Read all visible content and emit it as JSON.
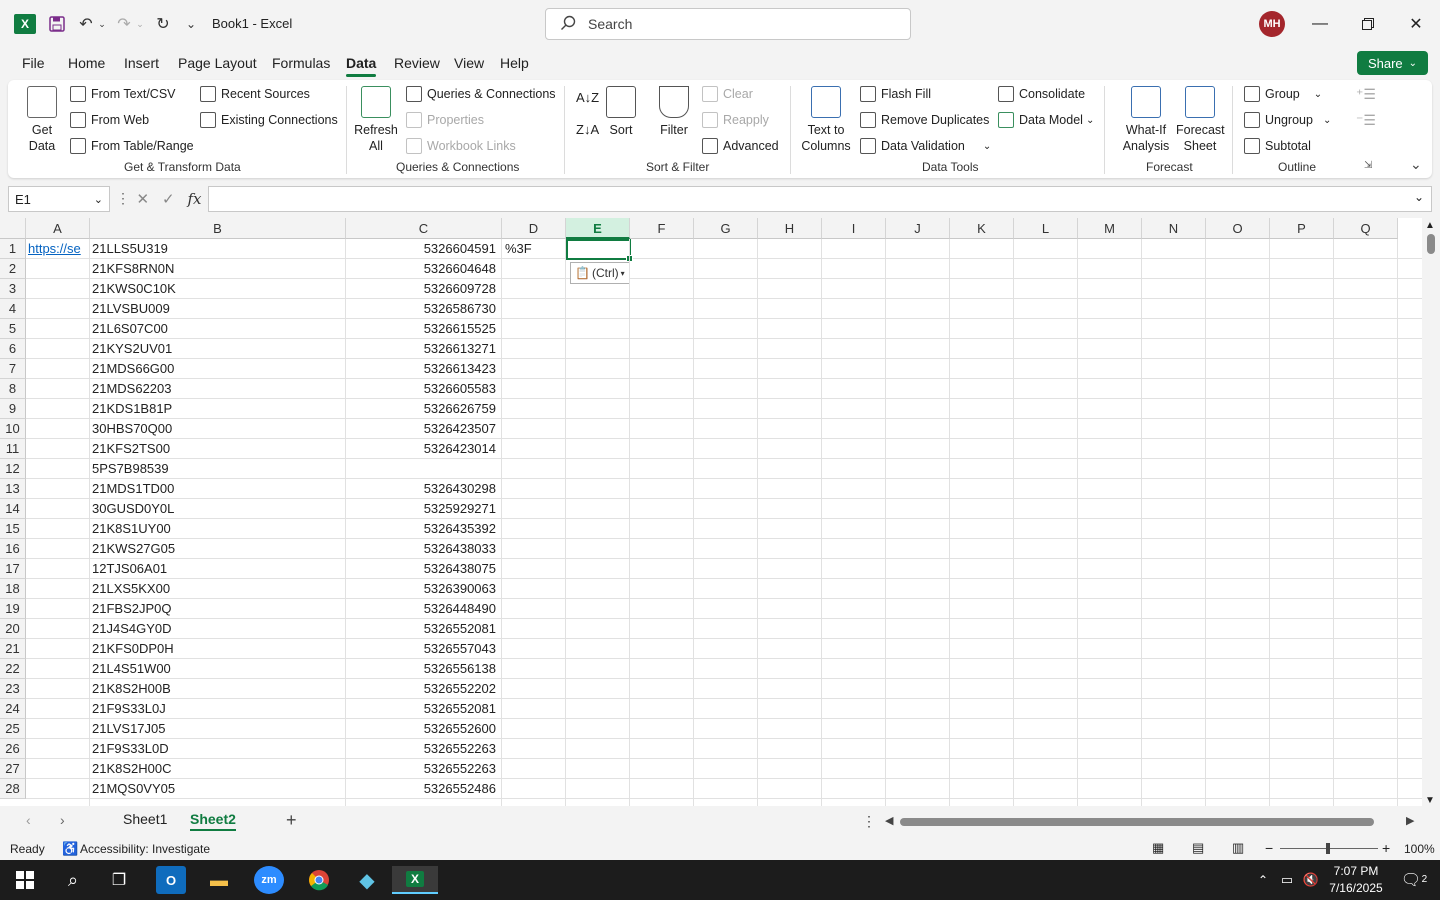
{
  "window": {
    "title": "Book1  -  Excel",
    "search_placeholder": "Search",
    "avatar_initials": "MH"
  },
  "menu": {
    "tabs": [
      "File",
      "Home",
      "Insert",
      "Page Layout",
      "Formulas",
      "Data",
      "Review",
      "View",
      "Help"
    ],
    "active": "Data",
    "share_label": "Share"
  },
  "ribbon": {
    "get_transform": {
      "get_data": "Get\nData",
      "from_text_csv": "From Text/CSV",
      "from_web": "From Web",
      "from_table": "From Table/Range",
      "recent_sources": "Recent Sources",
      "existing_connections": "Existing Connections",
      "group_label": "Get & Transform Data"
    },
    "queries": {
      "refresh_all": "Refresh\nAll",
      "queries_connections": "Queries & Connections",
      "properties": "Properties",
      "workbook_links": "Workbook Links",
      "group_label": "Queries & Connections"
    },
    "sort_filter": {
      "sort": "Sort",
      "filter": "Filter",
      "clear": "Clear",
      "reapply": "Reapply",
      "advanced": "Advanced",
      "group_label": "Sort & Filter"
    },
    "data_tools": {
      "text_to_columns": "Text to\nColumns",
      "flash_fill": "Flash Fill",
      "remove_duplicates": "Remove Duplicates",
      "data_validation": "Data Validation",
      "consolidate": "Consolidate",
      "data_model": "Data Model",
      "group_label": "Data Tools"
    },
    "forecast": {
      "what_if": "What-If\nAnalysis",
      "forecast_sheet": "Forecast\nSheet",
      "group_label": "Forecast"
    },
    "outline": {
      "group": "Group",
      "ungroup": "Ungroup",
      "subtotal": "Subtotal",
      "group_label": "Outline"
    }
  },
  "formula_bar": {
    "name_box": "E1",
    "formula": ""
  },
  "grid": {
    "columns": [
      "A",
      "B",
      "C",
      "D",
      "E",
      "F",
      "G",
      "H",
      "I",
      "J",
      "K",
      "L",
      "M",
      "N",
      "O",
      "P",
      "Q"
    ],
    "selected_column": "E",
    "rows": [
      {
        "n": "1",
        "a": "https://se",
        "b": "21LLS5U319",
        "c": "5326604591",
        "d": "%3F"
      },
      {
        "n": "2",
        "a": "",
        "b": "21KFS8RN0N",
        "c": "5326604648",
        "d": ""
      },
      {
        "n": "3",
        "a": "",
        "b": "21KWS0C10K",
        "c": "5326609728",
        "d": ""
      },
      {
        "n": "4",
        "a": "",
        "b": "21LVSBU009",
        "c": "5326586730",
        "d": ""
      },
      {
        "n": "5",
        "a": "",
        "b": "21L6S07C00",
        "c": "5326615525",
        "d": ""
      },
      {
        "n": "6",
        "a": "",
        "b": "21KYS2UV01",
        "c": "5326613271",
        "d": ""
      },
      {
        "n": "7",
        "a": "",
        "b": "21MDS66G00",
        "c": "5326613423",
        "d": ""
      },
      {
        "n": "8",
        "a": "",
        "b": "21MDS62203",
        "c": "5326605583",
        "d": ""
      },
      {
        "n": "9",
        "a": "",
        "b": "21KDS1B81P",
        "c": "5326626759",
        "d": ""
      },
      {
        "n": "10",
        "a": "",
        "b": "30HBS70Q00",
        "c": "5326423507",
        "d": ""
      },
      {
        "n": "11",
        "a": "",
        "b": "21KFS2TS00",
        "c": "5326423014",
        "d": ""
      },
      {
        "n": "12",
        "a": "",
        "b": "5PS7B98539",
        "c": "",
        "d": ""
      },
      {
        "n": "13",
        "a": "",
        "b": "21MDS1TD00",
        "c": "5326430298",
        "d": ""
      },
      {
        "n": "14",
        "a": "",
        "b": "30GUSD0Y0L",
        "c": "5325929271",
        "d": ""
      },
      {
        "n": "15",
        "a": "",
        "b": "21K8S1UY00",
        "c": "5326435392",
        "d": ""
      },
      {
        "n": "16",
        "a": "",
        "b": "21KWS27G05",
        "c": "5326438033",
        "d": ""
      },
      {
        "n": "17",
        "a": "",
        "b": "12TJS06A01",
        "c": "5326438075",
        "d": ""
      },
      {
        "n": "18",
        "a": "",
        "b": "21LXS5KX00",
        "c": "5326390063",
        "d": ""
      },
      {
        "n": "19",
        "a": "",
        "b": "21FBS2JP0Q",
        "c": "5326448490",
        "d": ""
      },
      {
        "n": "20",
        "a": "",
        "b": "21J4S4GY0D",
        "c": "5326552081",
        "d": ""
      },
      {
        "n": "21",
        "a": "",
        "b": "21KFS0DP0H",
        "c": "5326557043",
        "d": ""
      },
      {
        "n": "22",
        "a": "",
        "b": "21L4S51W00",
        "c": "5326556138",
        "d": ""
      },
      {
        "n": "23",
        "a": "",
        "b": "21K8S2H00B",
        "c": "5326552202",
        "d": ""
      },
      {
        "n": "24",
        "a": "",
        "b": "21F9S33L0J",
        "c": "5326552081",
        "d": ""
      },
      {
        "n": "25",
        "a": "",
        "b": "21LVS17J05",
        "c": "5326552600",
        "d": ""
      },
      {
        "n": "26",
        "a": "",
        "b": "21F9S33L0D",
        "c": "5326552263",
        "d": ""
      },
      {
        "n": "27",
        "a": "",
        "b": "21K8S2H00C",
        "c": "5326552263",
        "d": ""
      },
      {
        "n": "28",
        "a": "",
        "b": "21MQS0VY05",
        "c": "5326552486",
        "d": ""
      }
    ],
    "paste_options_label": "(Ctrl)"
  },
  "sheets": {
    "tabs": [
      "Sheet1",
      "Sheet2"
    ],
    "active": "Sheet2"
  },
  "status": {
    "ready": "Ready",
    "accessibility": "Accessibility: Investigate",
    "zoom": "100%"
  },
  "taskbar": {
    "time": "7:07 PM",
    "date": "7/16/2025",
    "notification_count": "2"
  },
  "colors": {
    "accent": "#107c41",
    "avatar": "#a4262c",
    "link": "#0563c1"
  }
}
